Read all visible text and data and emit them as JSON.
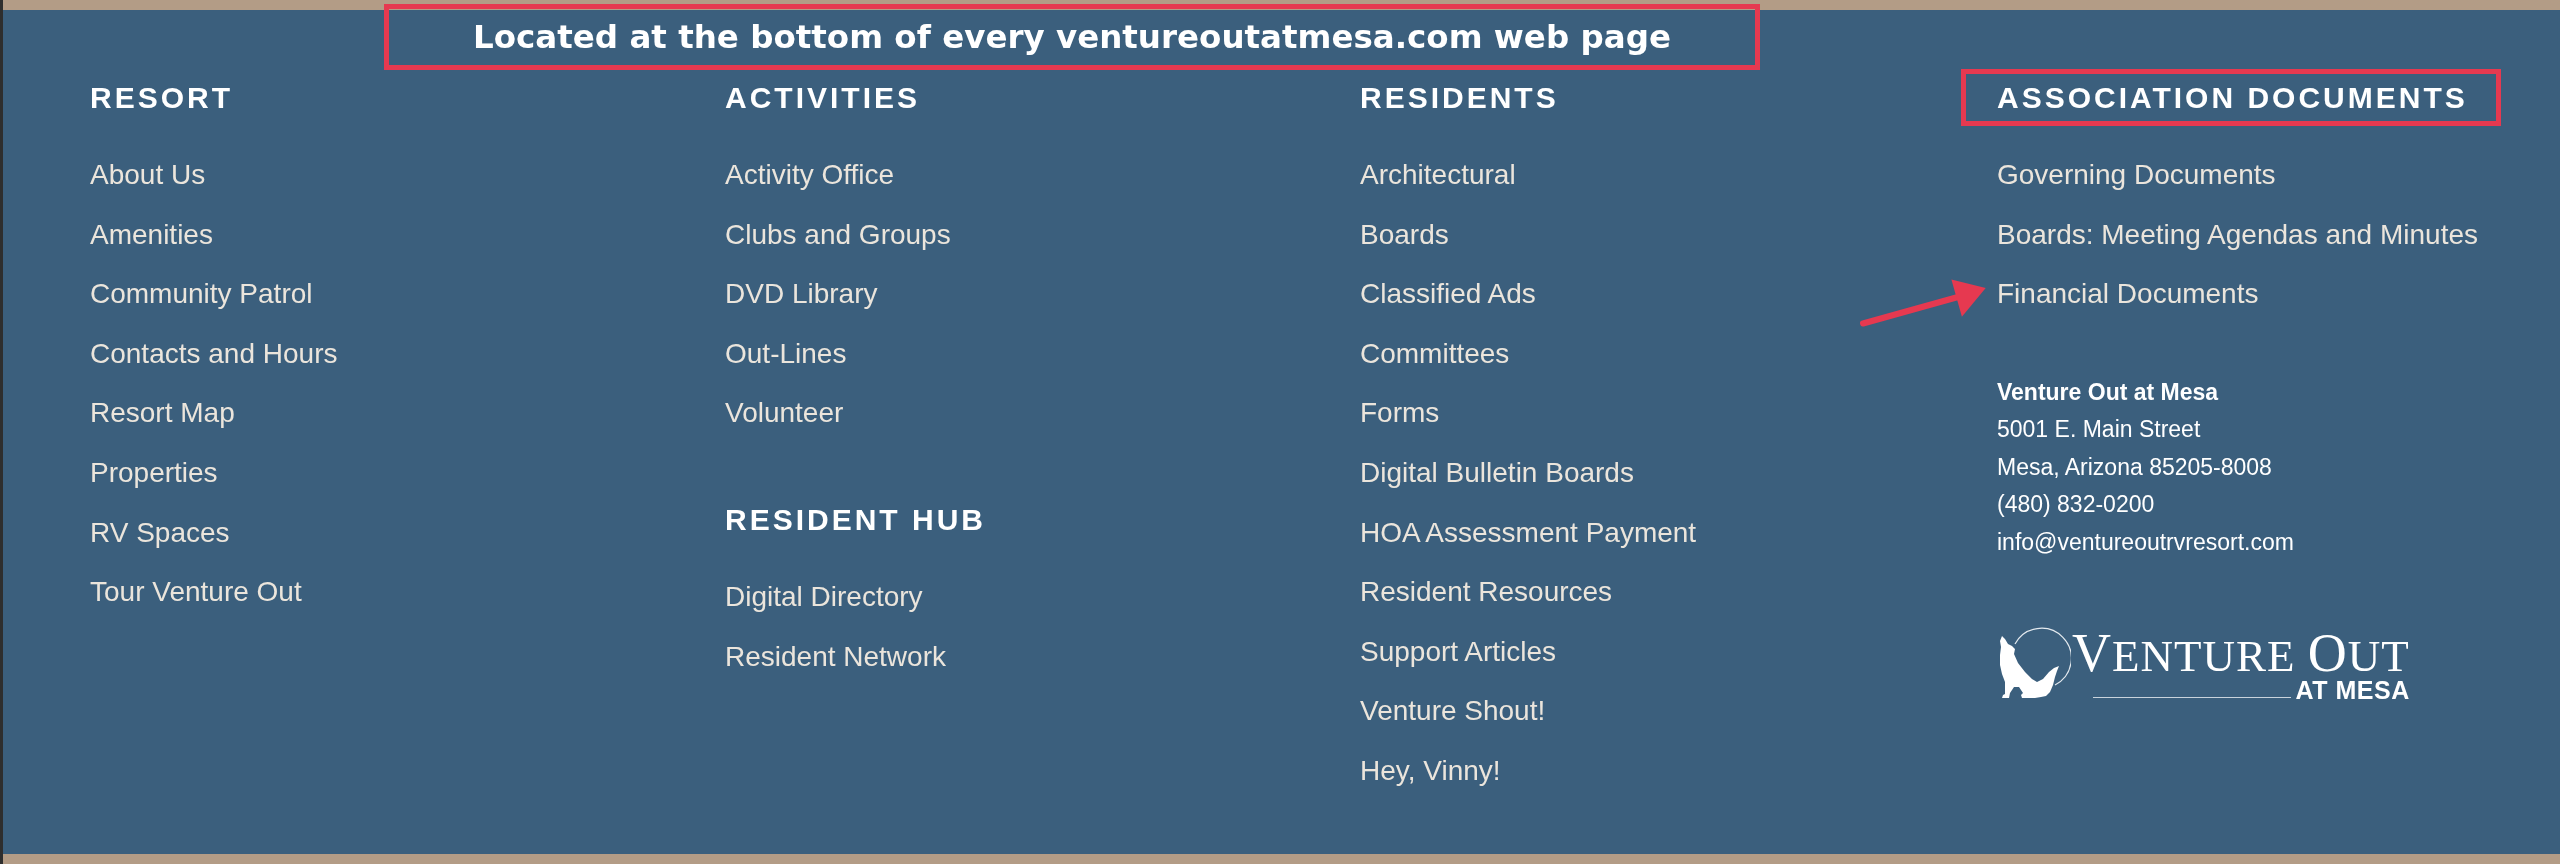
{
  "callout": {
    "text": "Located at the bottom of every ventureoutatmesa.com web page"
  },
  "columns": [
    {
      "sections": [
        {
          "heading": "RESORT",
          "highlighted": false,
          "links": [
            {
              "label": "About Us",
              "pointed_at": false
            },
            {
              "label": "Amenities",
              "pointed_at": false
            },
            {
              "label": "Community Patrol",
              "pointed_at": false
            },
            {
              "label": "Contacts and Hours",
              "pointed_at": false
            },
            {
              "label": "Resort Map",
              "pointed_at": false
            },
            {
              "label": "Properties",
              "pointed_at": false
            },
            {
              "label": "RV Spaces",
              "pointed_at": false
            },
            {
              "label": "Tour Venture Out",
              "pointed_at": false
            }
          ]
        }
      ]
    },
    {
      "sections": [
        {
          "heading": "ACTIVITIES",
          "highlighted": false,
          "links": [
            {
              "label": "Activity Office",
              "pointed_at": false
            },
            {
              "label": "Clubs and Groups",
              "pointed_at": false
            },
            {
              "label": "DVD Library",
              "pointed_at": false
            },
            {
              "label": "Out-Lines",
              "pointed_at": false
            },
            {
              "label": "Volunteer",
              "pointed_at": false
            }
          ]
        },
        {
          "heading": "RESIDENT HUB",
          "highlighted": false,
          "links": [
            {
              "label": "Digital Directory",
              "pointed_at": false
            },
            {
              "label": "Resident Network",
              "pointed_at": false
            }
          ]
        }
      ]
    },
    {
      "sections": [
        {
          "heading": "RESIDENTS",
          "highlighted": false,
          "links": [
            {
              "label": "Architectural",
              "pointed_at": false
            },
            {
              "label": "Boards",
              "pointed_at": false
            },
            {
              "label": "Classified Ads",
              "pointed_at": false
            },
            {
              "label": "Committees",
              "pointed_at": false
            },
            {
              "label": "Forms",
              "pointed_at": false
            },
            {
              "label": "Digital Bulletin Boards",
              "pointed_at": false
            },
            {
              "label": "HOA Assessment Payment",
              "pointed_at": false
            },
            {
              "label": "Resident Resources",
              "pointed_at": false
            },
            {
              "label": "Support Articles",
              "pointed_at": false
            },
            {
              "label": "Venture Shout!",
              "pointed_at": false
            },
            {
              "label": "Hey, Vinny!",
              "pointed_at": false
            }
          ]
        }
      ]
    },
    {
      "sections": [
        {
          "heading": "ASSOCIATION DOCUMENTS",
          "highlighted": true,
          "links": [
            {
              "label": "Governing Documents",
              "pointed_at": false
            },
            {
              "label": "Boards: Meeting Agendas and Minutes",
              "pointed_at": false
            },
            {
              "label": "Financial Documents",
              "pointed_at": true
            }
          ]
        }
      ],
      "address": {
        "name": "Venture Out at Mesa",
        "lines": [
          "5001 E. Main Street",
          "Mesa, Arizona 85205-8008",
          "(480) 832-0200",
          "info@ventureoutrvresort.com"
        ]
      },
      "logo": {
        "wordmark": "VENTURE OUT",
        "tagline": "AT MESA"
      }
    }
  ]
}
